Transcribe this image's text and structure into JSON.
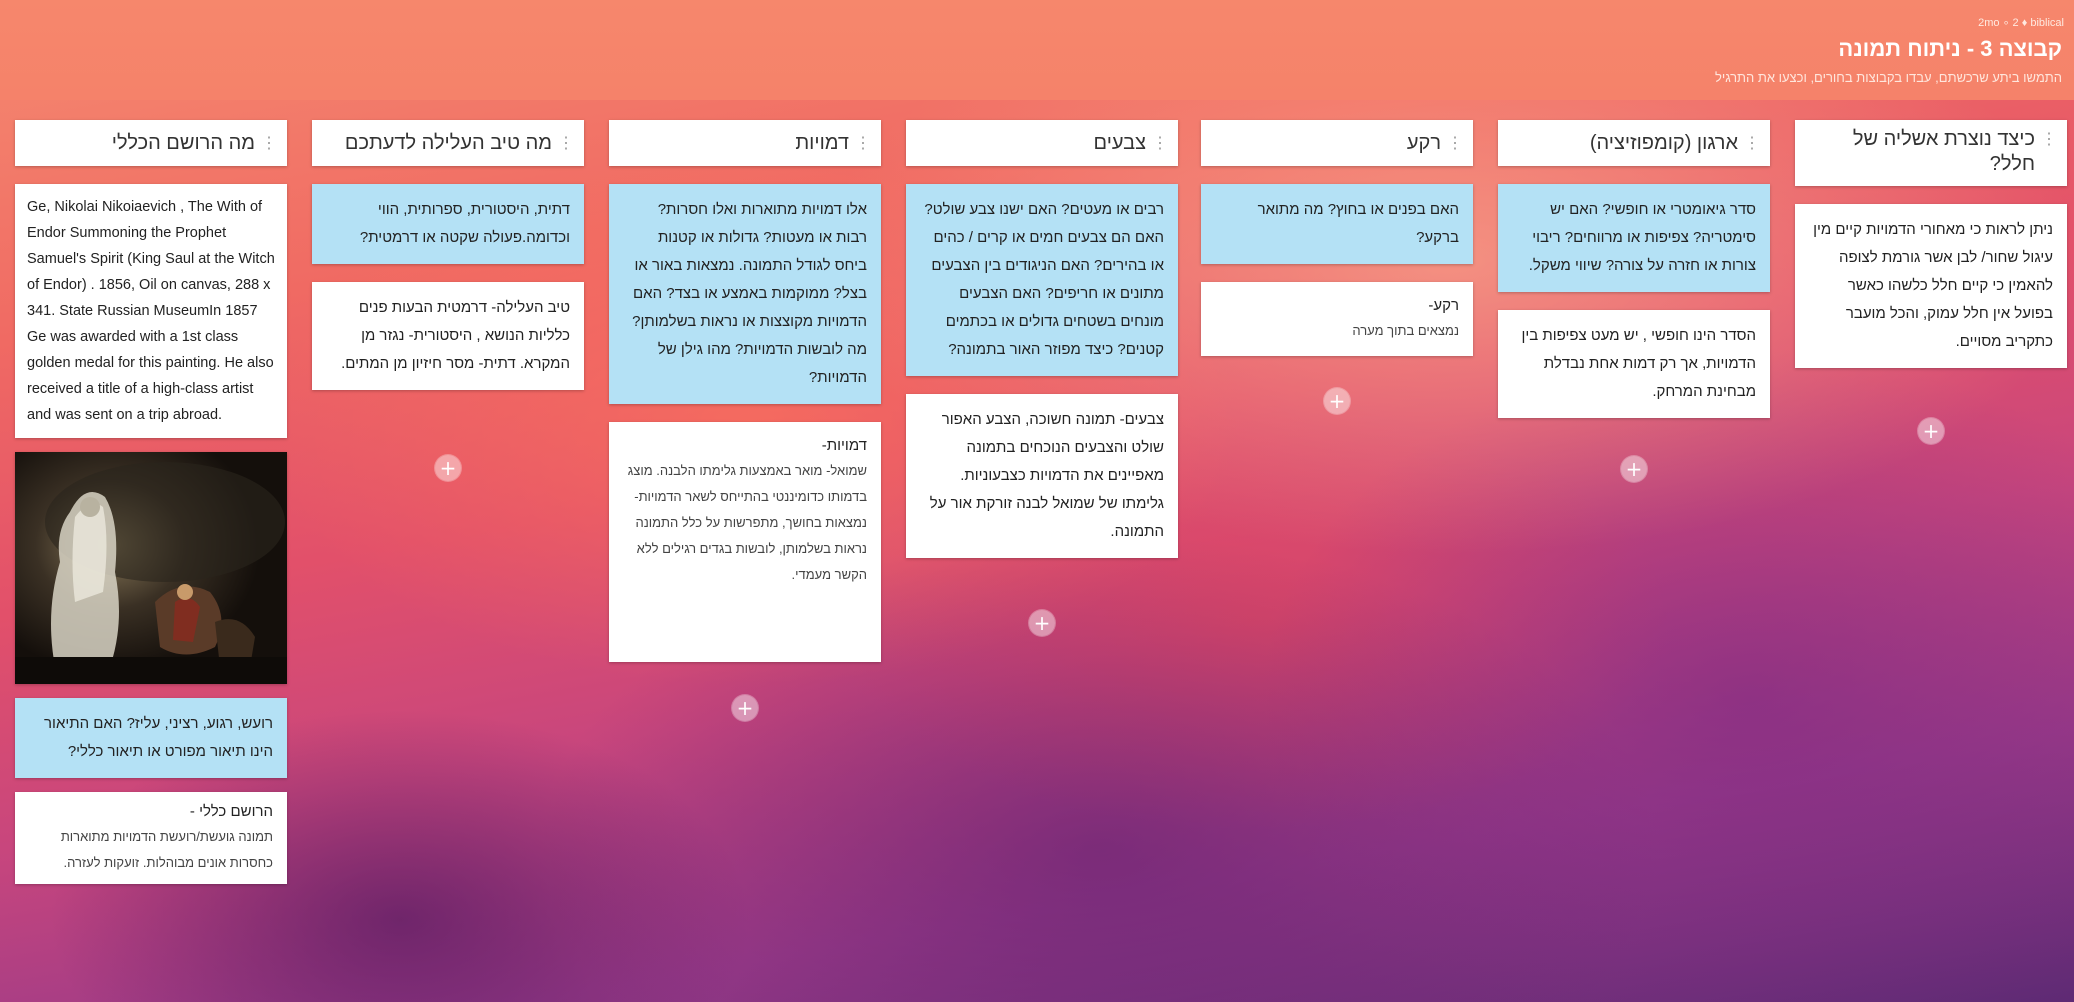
{
  "header": {
    "meta": "2mo ∘ 2 ♦ biblical",
    "title": "קבוצה 3 - ניתוח תמונה",
    "subtitle": "התמשו ביתע שרכשתם, עבדו בקבוצות בחורים, וכצעו את התרגיל"
  },
  "columns": [
    {
      "title": "כיצד נוצרת אשליה של חלל?",
      "cards": [
        {
          "type": "white",
          "text": "ניתן לראות כי מאחורי  הדמויות קיים מין עיגול שחור/ לבן אשר גורמת לצופה להאמין כי קיים חלל כלשהו כאשר בפועל אין חלל עמוק, והכל מועבר כתקריב מסויים."
        }
      ]
    },
    {
      "title": "ארגון (קומפוזיציה)",
      "cards": [
        {
          "type": "blue",
          "text": "סדר גיאומטרי או חופשי? האם יש סימטריה? צפיפות או מרווחים? ריבוי צורות או חזרה על צורה? שיווי משקל."
        },
        {
          "type": "white",
          "text": "הסדר הינו חופשי , יש מעט צפיפות בין הדמויות, אך רק דמות אחת נבדלת מבחינת המרחק."
        }
      ]
    },
    {
      "title": "רקע",
      "cards": [
        {
          "type": "blue",
          "text": "האם בפנים או בחוץ? מה מתואר ברקע?"
        },
        {
          "type": "white",
          "title": "רקע-",
          "body": "נמצאים בתוך מערה"
        }
      ]
    },
    {
      "title": "צבעים",
      "cards": [
        {
          "type": "blue",
          "text": "רבים או מעטים? האם ישנו צבע שולט? האם הם צבעים חמים או קרים / כהים או בהירים? האם הניגודים בין הצבעים מתונים או חריפים? האם הצבעים מונחים בשטחים גדולים או בכתמים קטנים?   כיצד מפוזר האור בתמונה?"
        },
        {
          "type": "white",
          "text": "צבעים- תמונה חשוכה, הצבע האפור שולט והצבעים הנוכחים בתמונה מאפיינים את הדמויות כצבעוניות. גלימתו של שמואל לבנה זורקת אור על התמונה."
        }
      ]
    },
    {
      "title": "דמויות",
      "cards": [
        {
          "type": "blue",
          "text": "אלו דמויות מתוארות ואלו חסרות? רבות או מעטות? גדולות או קטנות ביחס לגודל התמונה. נמצאות באור או בצל? ממוקמות באמצע או בצד? האם הדמויות מקוצצות או נראות בשלמותן? מה לובשות הדמויות? מהו גילן של הדמויות?"
        },
        {
          "type": "white",
          "title": "דמויות-",
          "body": "שמואל- מואר באמצעות גלימתו הלבנה. מוצג בדמותו כדומיננטי בהתייחס לשאר הדמויות- נמצאות בחושך, מתפרשות על כלל התמונה נראות בשלמותן, לובשות בגדים רגילים ללא הקשר מעמדי."
        }
      ]
    },
    {
      "title": "מה טיב העלילה לדעתכם",
      "cards": [
        {
          "type": "blue",
          "text": "דתית, היסטורית, ספרותית, הווי וכדומה.פעולה שקטה או דרמטית?"
        },
        {
          "type": "white",
          "text": "טיב העלילה- דרמטית הבעות פנים כלליות הנושא , היסטורית- נגזר מן המקרא. דתית- מסר חיזיון מן המתים."
        }
      ]
    },
    {
      "title": "מה הרושם הכללי",
      "cards": [
        {
          "type": "white",
          "ltr": true,
          "text": "Ge, Nikolai Nikoiaevich , The With of Endor Summoning the Prophet Samuel's Spirit (King Saul at the Witch of Endor) . 1856, Oil on canvas, 288 x 341. State Russian MuseumIn 1857 Ge was awarded with a 1st class golden medal for this painting. He also received a title of a high-class artist and was sent on a trip abroad."
        },
        {
          "type": "blue",
          "text": "רועש, רגוע, רציני, עליז? האם התיאור הינו תיאור מפורט או תיאור כללי?"
        },
        {
          "type": "white",
          "title": "הרושם כללי -",
          "body": "תמונה גועשת/רועשת הדמויות מתוארות כחסרות אונים מבוהלות. זועקות לעזרה."
        }
      ]
    }
  ],
  "add_button_label": "+"
}
